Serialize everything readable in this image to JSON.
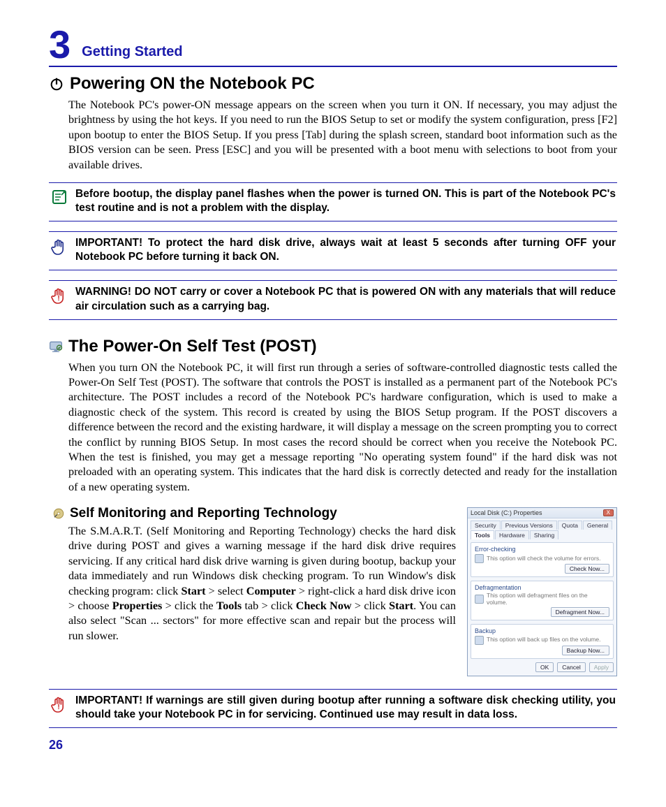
{
  "chapter": {
    "number": "3",
    "title": "Getting Started"
  },
  "section1": {
    "heading": "Powering ON the Notebook PC",
    "body": "The Notebook PC's power-ON message appears on the screen when you turn it ON. If necessary, you may adjust the brightness by using the hot keys. If you need to run the BIOS Setup to set or modify the system configuration, press [F2] upon bootup to enter the BIOS Setup. If you press [Tab] during the splash screen, standard boot information such as the BIOS version can be seen. Press [ESC] and you will be presented with a boot menu with selections to boot from your available drives."
  },
  "callouts": {
    "note": "Before bootup, the display panel flashes when the power is turned ON. This is part of the Notebook PC's test routine and is not a problem with the display.",
    "important1": "IMPORTANT!  To protect the hard disk drive, always wait at least 5 seconds after turning OFF your Notebook PC before turning it back ON.",
    "warning": "WARNING! DO NOT carry or cover a Notebook PC that is powered ON with any materials that will reduce air circulation such as a carrying bag.",
    "important2": "IMPORTANT! If warnings are still given during bootup after running a software disk checking utility, you should take your Notebook PC in for servicing. Continued use may result in data loss."
  },
  "section2": {
    "heading": "The Power-On Self Test (POST)",
    "body": "When you turn ON the Notebook PC, it will first run through a series of software-controlled diagnostic tests called the Power-On Self Test (POST). The software that controls the POST is installed as a permanent part of the Notebook PC's architecture. The POST includes a record of the Notebook PC's hardware configuration, which is used to make a diagnostic check of the system. This record is created by using the BIOS Setup program. If the POST discovers a difference between the record and the existing hardware, it will display a message on the screen prompting you to correct the conflict by running BIOS Setup. In most cases the record should be correct when you receive the Notebook PC. When the test is finished, you may get a message reporting \"No operating system found\" if the hard disk was not preloaded with an operating system. This indicates that the hard disk is correctly detected and ready for the installation of a new operating system."
  },
  "section3": {
    "heading": "Self Monitoring and Reporting Technology",
    "prefix": "The S.M.A.R.T. (Self Monitoring and Reporting Technology) checks the hard disk drive during POST and gives a warning message if the hard disk drive requires servicing. If any critical hard disk drive warning is given during bootup, backup your data immediately and run Windows disk checking program. To run Window's disk checking program: click ",
    "b1": "Start",
    "s1": " > select ",
    "b2": "Computer",
    "s2": " > right-click a hard disk drive icon > choose ",
    "b3": "Properties",
    "s3": " > click the ",
    "b4": "Tools",
    "s4": " tab > click ",
    "b5": "Check Now",
    "s5": " > click ",
    "b6": "Start",
    "suffix": ". You can also select \"Scan ... sectors\" for more effective scan and repair but the process will run slower."
  },
  "dialog": {
    "title": "Local Disk (C:) Properties",
    "close": "X",
    "tabs": {
      "security": "Security",
      "previous": "Previous Versions",
      "quota": "Quota",
      "general": "General",
      "tools": "Tools",
      "hardware": "Hardware",
      "sharing": "Sharing"
    },
    "group1": {
      "title": "Error-checking",
      "text": "This option will check the volume for errors.",
      "btn": "Check Now..."
    },
    "group2": {
      "title": "Defragmentation",
      "text": "This option will defragment files on the volume.",
      "btn": "Defragment Now..."
    },
    "group3": {
      "title": "Backup",
      "text": "This option will back up files on the volume.",
      "btn": "Backup Now..."
    },
    "ok": "OK",
    "cancel": "Cancel",
    "apply": "Apply"
  },
  "page_number": "26"
}
